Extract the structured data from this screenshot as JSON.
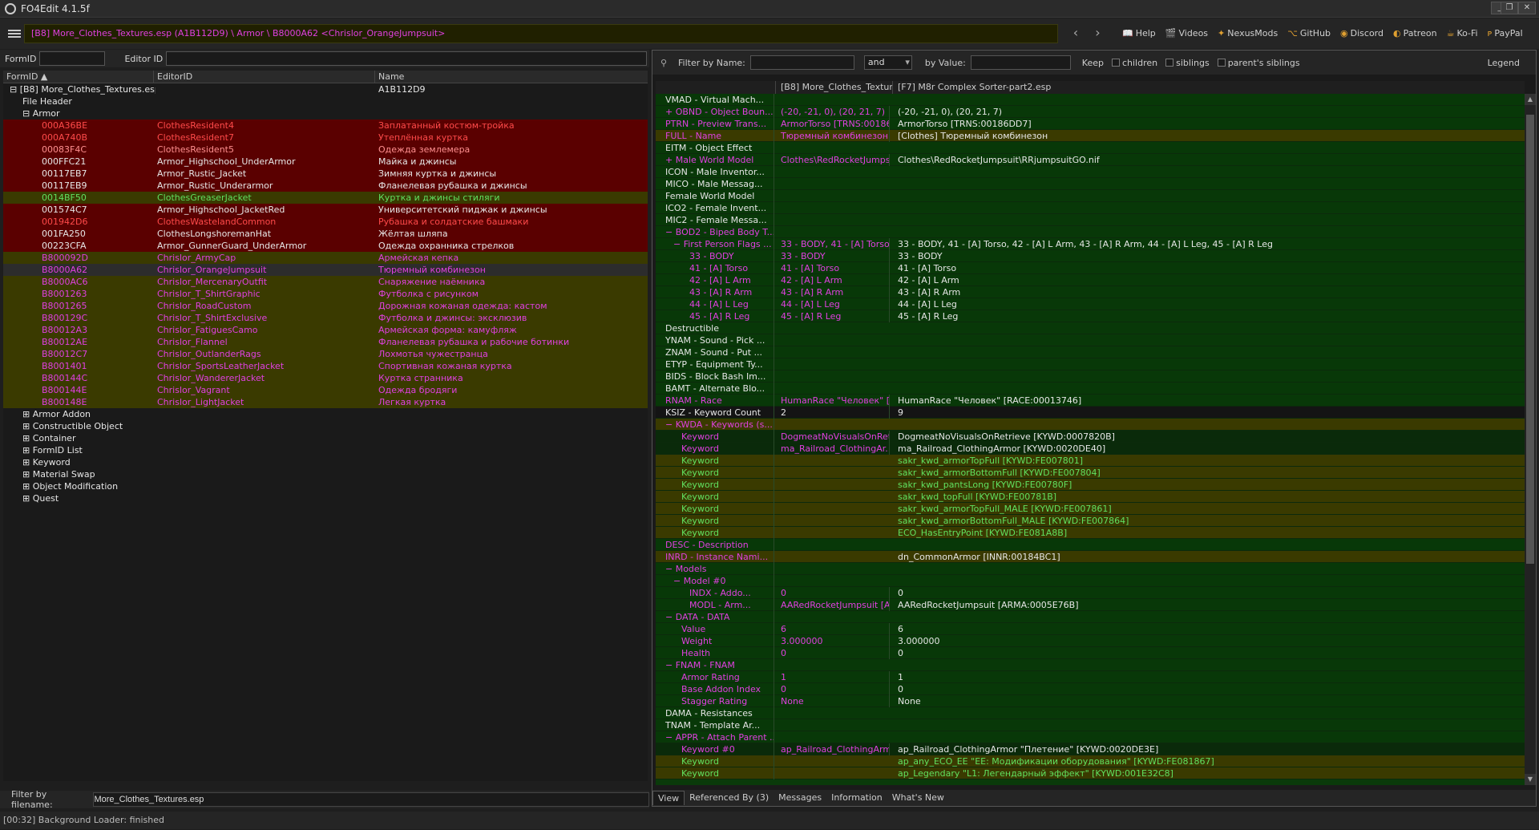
{
  "window": {
    "title": "FO4Edit 4.1.5f"
  },
  "path": "[B8] More_Clothes_Textures.esp (A1B112D9) \\ Armor \\ B8000A62 <Chrislor_OrangeJumpsuit>",
  "links": [
    "Help",
    "Videos",
    "NexusMods",
    "GitHub",
    "Discord",
    "Patreon",
    "Ko-Fi",
    "PayPal"
  ],
  "formid_label": "FormID",
  "editorid_label": "Editor ID",
  "left_cols": [
    "FormID ▲",
    "EditorID",
    "Name"
  ],
  "left_rows": [
    {
      "fid": "[B8] More_Clothes_Textures.esp",
      "eid": "",
      "name": "A1B112D9",
      "bg": "",
      "fc": "fc-white",
      "ind": 1,
      "tree": "⊟"
    },
    {
      "fid": "File Header",
      "eid": "",
      "name": "",
      "bg": "",
      "fc": "fc-white",
      "ind": 3,
      "tree": ""
    },
    {
      "fid": "Armor",
      "eid": "",
      "name": "",
      "bg": "",
      "fc": "fc-white",
      "ind": 3,
      "tree": "⊟"
    },
    {
      "fid": "000A36BE",
      "eid": "ClothesResident4",
      "name": "Заплатанный костюм-тройка",
      "bg": "bg-red",
      "fc": "fc-red",
      "ind": 6,
      "tree": ""
    },
    {
      "fid": "000A740B",
      "eid": "ClothesResident7",
      "name": "Утеплённая куртка",
      "bg": "bg-red",
      "fc": "fc-red",
      "ind": 6,
      "tree": ""
    },
    {
      "fid": "00083F4C",
      "eid": "ClothesResident5",
      "name": "Одежда землемера",
      "bg": "bg-red",
      "fc": "fc-lred",
      "ind": 6,
      "tree": ""
    },
    {
      "fid": "000FFC21",
      "eid": "Armor_Highschool_UnderArmor",
      "name": "Майка и джинсы",
      "bg": "bg-red",
      "fc": "fc-white",
      "ind": 6,
      "tree": ""
    },
    {
      "fid": "00117EB7",
      "eid": "Armor_Rustic_Jacket",
      "name": "Зимняя куртка и джинсы",
      "bg": "bg-red",
      "fc": "fc-white",
      "ind": 6,
      "tree": ""
    },
    {
      "fid": "00117EB9",
      "eid": "Armor_Rustic_Underarmor",
      "name": "Фланелевая рубашка и джинсы",
      "bg": "bg-red",
      "fc": "fc-white",
      "ind": 6,
      "tree": ""
    },
    {
      "fid": "0014BF50",
      "eid": "ClothesGreaserJacket",
      "name": "Куртка и джинсы стиляги",
      "bg": "bg-olive",
      "fc": "fc-green",
      "ind": 6,
      "tree": ""
    },
    {
      "fid": "001574C7",
      "eid": "Armor_Highschool_JacketRed",
      "name": "Университетский пиджак и джинсы",
      "bg": "bg-red",
      "fc": "fc-white",
      "ind": 6,
      "tree": ""
    },
    {
      "fid": "001942D6",
      "eid": "ClothesWastelandCommon",
      "name": "Рубашка и солдатские башмаки",
      "bg": "bg-red",
      "fc": "fc-red",
      "ind": 6,
      "tree": ""
    },
    {
      "fid": "001FA250",
      "eid": "ClothesLongshoremanHat",
      "name": "Жёлтая шляпа",
      "bg": "bg-red",
      "fc": "fc-white",
      "ind": 6,
      "tree": ""
    },
    {
      "fid": "00223CFA",
      "eid": "Armor_GunnerGuard_UnderArmor",
      "name": "Одежда охранника стрелков",
      "bg": "bg-red",
      "fc": "fc-white",
      "ind": 6,
      "tree": ""
    },
    {
      "fid": "B800092D",
      "eid": "Chrislor_ArmyCap",
      "name": "Армейская кепка",
      "bg": "bg-olive",
      "fc": "fc-mag",
      "ind": 6,
      "tree": ""
    },
    {
      "fid": "B8000A62",
      "eid": "Chrislor_OrangeJumpsuit",
      "name": "Тюремный комбинезон",
      "bg": "bg-sel",
      "fc": "fc-mag",
      "ind": 6,
      "tree": ""
    },
    {
      "fid": "B8000AC6",
      "eid": "Chrislor_MercenaryOutfit",
      "name": "Снаряжение наёмника",
      "bg": "bg-olive",
      "fc": "fc-mag",
      "ind": 6,
      "tree": ""
    },
    {
      "fid": "B8001263",
      "eid": "Chrislor_T_ShirtGraphic",
      "name": "Футболка с рисунком",
      "bg": "bg-olive",
      "fc": "fc-mag",
      "ind": 6,
      "tree": ""
    },
    {
      "fid": "B8001265",
      "eid": "Chrislor_RoadCustom",
      "name": "Дорожная кожаная одежда: кастом",
      "bg": "bg-olive",
      "fc": "fc-mag",
      "ind": 6,
      "tree": ""
    },
    {
      "fid": "B800129C",
      "eid": "Chrislor_T_ShirtExclusive",
      "name": "Футболка и джинсы: эксклюзив",
      "bg": "bg-olive",
      "fc": "fc-mag",
      "ind": 6,
      "tree": ""
    },
    {
      "fid": "B80012A3",
      "eid": "Chrislor_FatiguesCamo",
      "name": "Армейская форма: камуфляж",
      "bg": "bg-olive",
      "fc": "fc-mag",
      "ind": 6,
      "tree": ""
    },
    {
      "fid": "B80012AE",
      "eid": "Chrislor_Flannel",
      "name": "Фланелевая рубашка и рабочие ботинки",
      "bg": "bg-olive",
      "fc": "fc-mag",
      "ind": 6,
      "tree": ""
    },
    {
      "fid": "B80012C7",
      "eid": "Chrislor_OutlanderRags",
      "name": "Лохмотья чужестранца",
      "bg": "bg-olive",
      "fc": "fc-mag",
      "ind": 6,
      "tree": ""
    },
    {
      "fid": "B8001401",
      "eid": "Chrislor_SportsLeatherJacket",
      "name": "Спортивная кожаная куртка",
      "bg": "bg-olive",
      "fc": "fc-mag",
      "ind": 6,
      "tree": ""
    },
    {
      "fid": "B800144C",
      "eid": "Chrislor_WandererJacket",
      "name": "Куртка странника",
      "bg": "bg-olive",
      "fc": "fc-mag",
      "ind": 6,
      "tree": ""
    },
    {
      "fid": "B800144E",
      "eid": "Chrislor_Vagrant",
      "name": "Одежда бродяги",
      "bg": "bg-olive",
      "fc": "fc-mag",
      "ind": 6,
      "tree": ""
    },
    {
      "fid": "B800148E",
      "eid": "Chrislor_LightJacket",
      "name": "Легкая куртка",
      "bg": "bg-olive",
      "fc": "fc-mag",
      "ind": 6,
      "tree": ""
    },
    {
      "fid": "Armor Addon",
      "eid": "",
      "name": "",
      "bg": "",
      "fc": "fc-white",
      "ind": 3,
      "tree": "⊞"
    },
    {
      "fid": "Constructible Object",
      "eid": "",
      "name": "",
      "bg": "",
      "fc": "fc-white",
      "ind": 3,
      "tree": "⊞"
    },
    {
      "fid": "Container",
      "eid": "",
      "name": "",
      "bg": "",
      "fc": "fc-white",
      "ind": 3,
      "tree": "⊞"
    },
    {
      "fid": "FormID List",
      "eid": "",
      "name": "",
      "bg": "",
      "fc": "fc-white",
      "ind": 3,
      "tree": "⊞"
    },
    {
      "fid": "Keyword",
      "eid": "",
      "name": "",
      "bg": "",
      "fc": "fc-white",
      "ind": 3,
      "tree": "⊞"
    },
    {
      "fid": "Material Swap",
      "eid": "",
      "name": "",
      "bg": "",
      "fc": "fc-white",
      "ind": 3,
      "tree": "⊞"
    },
    {
      "fid": "Object Modification",
      "eid": "",
      "name": "",
      "bg": "",
      "fc": "fc-white",
      "ind": 3,
      "tree": "⊞"
    },
    {
      "fid": "Quest",
      "eid": "",
      "name": "",
      "bg": "",
      "fc": "fc-white",
      "ind": 3,
      "tree": "⊞"
    }
  ],
  "filename_filter": {
    "label": "Filter by filename:",
    "value": "More_Clothes_Textures.esp"
  },
  "status": "[00:32] Background Loader: finished",
  "filter": {
    "by_name": "Filter by Name:",
    "op": "and",
    "by_value": "by Value:",
    "keep": "Keep",
    "children": "children",
    "siblings": "siblings",
    "parents": "parent's siblings",
    "legend": "Legend"
  },
  "right_cols": [
    "",
    "[B8] More_Clothes_Texture...",
    "[F7] M8r Complex Sorter-part2.esp"
  ],
  "right_rows": [
    {
      "l": "VMAD - Virtual Mach...",
      "v1": "",
      "v2": "",
      "bg": "rg",
      "fc": "fc-white",
      "ind": 0
    },
    {
      "l": "OBND - Object Boun...",
      "v1": "(-20, -21, 0), (20, 21, 7)",
      "v2": "(-20, -21, 0), (20, 21, 7)",
      "bg": "rg",
      "fc": "fc-mag",
      "ind": 0,
      "t": "+"
    },
    {
      "l": "PTRN - Preview Trans...",
      "v1": "ArmorTorso [TRNS:00186...",
      "v2": "ArmorTorso [TRNS:00186DD7]",
      "bg": "rg",
      "fc": "fc-mag",
      "ind": 0
    },
    {
      "l": "FULL - Name",
      "v1": "Тюремный комбинезон",
      "v2": "[Clothes] Тюремный комбинезон",
      "bg": "ro",
      "fc": "fc-mag",
      "ind": 0
    },
    {
      "l": "EITM - Object Effect",
      "v1": "",
      "v2": "",
      "bg": "rg",
      "fc": "fc-white",
      "ind": 0
    },
    {
      "l": "Male World Model",
      "v1": "Clothes\\RedRocketJumps...",
      "v2": "Clothes\\RedRocketJumpsuit\\RRjumpsuitGO.nif",
      "bg": "rg",
      "fc": "fc-mag",
      "ind": 0,
      "t": "+"
    },
    {
      "l": "ICON - Male Inventor...",
      "v1": "",
      "v2": "",
      "bg": "rg",
      "fc": "fc-white",
      "ind": 0
    },
    {
      "l": "MICO - Male Messag...",
      "v1": "",
      "v2": "",
      "bg": "rg",
      "fc": "fc-white",
      "ind": 0
    },
    {
      "l": "Female World Model",
      "v1": "",
      "v2": "",
      "bg": "rg",
      "fc": "fc-white",
      "ind": 0
    },
    {
      "l": "ICO2 - Female Invent...",
      "v1": "",
      "v2": "",
      "bg": "rg",
      "fc": "fc-white",
      "ind": 0
    },
    {
      "l": "MIC2 - Female Messa...",
      "v1": "",
      "v2": "",
      "bg": "rg",
      "fc": "fc-white",
      "ind": 0
    },
    {
      "l": "BOD2 - Biped Body T...",
      "v1": "",
      "v2": "",
      "bg": "rg",
      "fc": "fc-mag",
      "ind": 0,
      "t": "−"
    },
    {
      "l": "First Person Flags ...",
      "v1": "33 - BODY, 41 - [A] Torso...",
      "v2": "33 - BODY, 41 - [A] Torso, 42 - [A] L Arm, 43 - [A] R Arm, 44 - [A] L Leg, 45 - [A] R Leg",
      "bg": "rg",
      "fc": "fc-mag",
      "ind": 1,
      "t": "−"
    },
    {
      "l": "33 - BODY",
      "v1": "33 - BODY",
      "v2": "33 - BODY",
      "bg": "rg",
      "fc": "fc-mag",
      "ind": 3
    },
    {
      "l": "41 - [A] Torso",
      "v1": "41 - [A] Torso",
      "v2": "41 - [A] Torso",
      "bg": "rg",
      "fc": "fc-mag",
      "ind": 3
    },
    {
      "l": "42 - [A] L Arm",
      "v1": "42 - [A] L Arm",
      "v2": "42 - [A] L Arm",
      "bg": "rg",
      "fc": "fc-mag",
      "ind": 3
    },
    {
      "l": "43 - [A] R Arm",
      "v1": "43 - [A] R Arm",
      "v2": "43 - [A] R Arm",
      "bg": "rg",
      "fc": "fc-mag",
      "ind": 3
    },
    {
      "l": "44 - [A] L Leg",
      "v1": "44 - [A] L Leg",
      "v2": "44 - [A] L Leg",
      "bg": "rg",
      "fc": "fc-mag",
      "ind": 3
    },
    {
      "l": "45 - [A] R Leg",
      "v1": "45 - [A] R Leg",
      "v2": "45 - [A] R Leg",
      "bg": "rg",
      "fc": "fc-mag",
      "ind": 3
    },
    {
      "l": "Destructible",
      "v1": "",
      "v2": "",
      "bg": "rg",
      "fc": "fc-white",
      "ind": 0
    },
    {
      "l": "YNAM - Sound - Pick ...",
      "v1": "",
      "v2": "",
      "bg": "rg",
      "fc": "fc-white",
      "ind": 0
    },
    {
      "l": "ZNAM - Sound - Put ...",
      "v1": "",
      "v2": "",
      "bg": "rg",
      "fc": "fc-white",
      "ind": 0
    },
    {
      "l": "ETYP - Equipment Ty...",
      "v1": "",
      "v2": "",
      "bg": "rg",
      "fc": "fc-white",
      "ind": 0
    },
    {
      "l": "BIDS - Block Bash Im...",
      "v1": "",
      "v2": "",
      "bg": "rg",
      "fc": "fc-white",
      "ind": 0
    },
    {
      "l": "BAMT - Alternate Blo...",
      "v1": "",
      "v2": "",
      "bg": "rg",
      "fc": "fc-white",
      "ind": 0
    },
    {
      "l": "RNAM - Race",
      "v1": "HumanRace \"Человек\" [...",
      "v2": "HumanRace \"Человек\" [RACE:00013746]",
      "bg": "rg",
      "fc": "fc-mag",
      "ind": 0
    },
    {
      "l": "KSIZ - Keyword Count",
      "v1": "2",
      "v2": "9",
      "bg": "rsel",
      "fc": "fc-white",
      "ind": 0
    },
    {
      "l": "KWDA - Keywords (s...",
      "v1": "",
      "v2": "",
      "bg": "ro",
      "fc": "fc-mag",
      "ind": 0,
      "t": "−"
    },
    {
      "l": "Keyword",
      "v1": "DogmeatNoVisualsOnRet...",
      "v2": "DogmeatNoVisualsOnRetrieve [KYWD:0007820B]",
      "bg": "rgd",
      "fc": "fc-mag",
      "ind": 2
    },
    {
      "l": "Keyword",
      "v1": "ma_Railroad_ClothingAr...",
      "v2": "ma_Railroad_ClothingArmor [KYWD:0020DE40]",
      "bg": "rgd",
      "fc": "fc-mag",
      "ind": 2
    },
    {
      "l": "Keyword",
      "v1": "",
      "v2": "sakr_kwd_armorTopFull [KYWD:FE007801]",
      "bg": "ro",
      "fc": "fc-green",
      "ind": 2
    },
    {
      "l": "Keyword",
      "v1": "",
      "v2": "sakr_kwd_armorBottomFull [KYWD:FE007804]",
      "bg": "ro",
      "fc": "fc-green",
      "ind": 2
    },
    {
      "l": "Keyword",
      "v1": "",
      "v2": "sakr_kwd_pantsLong [KYWD:FE00780F]",
      "bg": "ro",
      "fc": "fc-green",
      "ind": 2
    },
    {
      "l": "Keyword",
      "v1": "",
      "v2": "sakr_kwd_topFull [KYWD:FE00781B]",
      "bg": "ro",
      "fc": "fc-green",
      "ind": 2
    },
    {
      "l": "Keyword",
      "v1": "",
      "v2": "sakr_kwd_armorTopFull_MALE [KYWD:FE007861]",
      "bg": "ro",
      "fc": "fc-green",
      "ind": 2
    },
    {
      "l": "Keyword",
      "v1": "",
      "v2": "sakr_kwd_armorBottomFull_MALE [KYWD:FE007864]",
      "bg": "ro",
      "fc": "fc-green",
      "ind": 2
    },
    {
      "l": "Keyword",
      "v1": "",
      "v2": "ECO_HasEntryPoint [KYWD:FE081A8B]",
      "bg": "ro",
      "fc": "fc-green",
      "ind": 2
    },
    {
      "l": "DESC - Description",
      "v1": "",
      "v2": "",
      "bg": "rg",
      "fc": "fc-mag",
      "ind": 0
    },
    {
      "l": "INRD - Instance Nami...",
      "v1": "",
      "v2": "dn_CommonArmor [INNR:00184BC1]",
      "bg": "ro",
      "fc": "fc-mag",
      "ind": 0
    },
    {
      "l": "Models",
      "v1": "",
      "v2": "",
      "bg": "rg",
      "fc": "fc-mag",
      "ind": 0,
      "t": "−"
    },
    {
      "l": "Model #0",
      "v1": "",
      "v2": "",
      "bg": "rg",
      "fc": "fc-mag",
      "ind": 1,
      "t": "−"
    },
    {
      "l": "INDX - Addo...",
      "v1": "0",
      "v2": "0",
      "bg": "rg",
      "fc": "fc-mag",
      "ind": 3
    },
    {
      "l": "MODL - Arm...",
      "v1": "AARedRocketJumpsuit [A...",
      "v2": "AARedRocketJumpsuit [ARMA:0005E76B]",
      "bg": "rg",
      "fc": "fc-mag",
      "ind": 3
    },
    {
      "l": "DATA - DATA",
      "v1": "",
      "v2": "",
      "bg": "rg",
      "fc": "fc-mag",
      "ind": 0,
      "t": "−"
    },
    {
      "l": "Value",
      "v1": "6",
      "v2": "6",
      "bg": "rg",
      "fc": "fc-mag",
      "ind": 2
    },
    {
      "l": "Weight",
      "v1": "3.000000",
      "v2": "3.000000",
      "bg": "rg",
      "fc": "fc-mag",
      "ind": 2
    },
    {
      "l": "Health",
      "v1": "0",
      "v2": "0",
      "bg": "rg",
      "fc": "fc-mag",
      "ind": 2
    },
    {
      "l": "FNAM - FNAM",
      "v1": "",
      "v2": "",
      "bg": "rg",
      "fc": "fc-mag",
      "ind": 0,
      "t": "−"
    },
    {
      "l": "Armor Rating",
      "v1": "1",
      "v2": "1",
      "bg": "rg",
      "fc": "fc-mag",
      "ind": 2
    },
    {
      "l": "Base Addon Index",
      "v1": "0",
      "v2": "0",
      "bg": "rg",
      "fc": "fc-mag",
      "ind": 2
    },
    {
      "l": "Stagger Rating",
      "v1": "None",
      "v2": "None",
      "bg": "rg",
      "fc": "fc-mag",
      "ind": 2
    },
    {
      "l": "DAMA - Resistances",
      "v1": "",
      "v2": "",
      "bg": "rg",
      "fc": "fc-white",
      "ind": 0
    },
    {
      "l": "TNAM - Template Ar...",
      "v1": "",
      "v2": "",
      "bg": "rg",
      "fc": "fc-white",
      "ind": 0
    },
    {
      "l": "APPR - Attach Parent ...",
      "v1": "",
      "v2": "",
      "bg": "rg",
      "fc": "fc-mag",
      "ind": 0,
      "t": "−"
    },
    {
      "l": "Keyword #0",
      "v1": "ap_Railroad_ClothingArm...",
      "v2": "ap_Railroad_ClothingArmor \"Плетение\" [KYWD:0020DE3E]",
      "bg": "rgd",
      "fc": "fc-mag",
      "ind": 2
    },
    {
      "l": "Keyword",
      "v1": "",
      "v2": "ap_any_ECO_EE \"EE: Модификации оборудования\" [KYWD:FE081867]",
      "bg": "ro",
      "fc": "fc-green",
      "ind": 2
    },
    {
      "l": "Keyword",
      "v1": "",
      "v2": "ap_Legendary \"L1: Легендарный эффект\" [KYWD:001E32C8]",
      "bg": "ro",
      "fc": "fc-green",
      "ind": 2
    }
  ],
  "bottom_tabs": [
    "View",
    "Referenced By (3)",
    "Messages",
    "Information",
    "What's New"
  ]
}
